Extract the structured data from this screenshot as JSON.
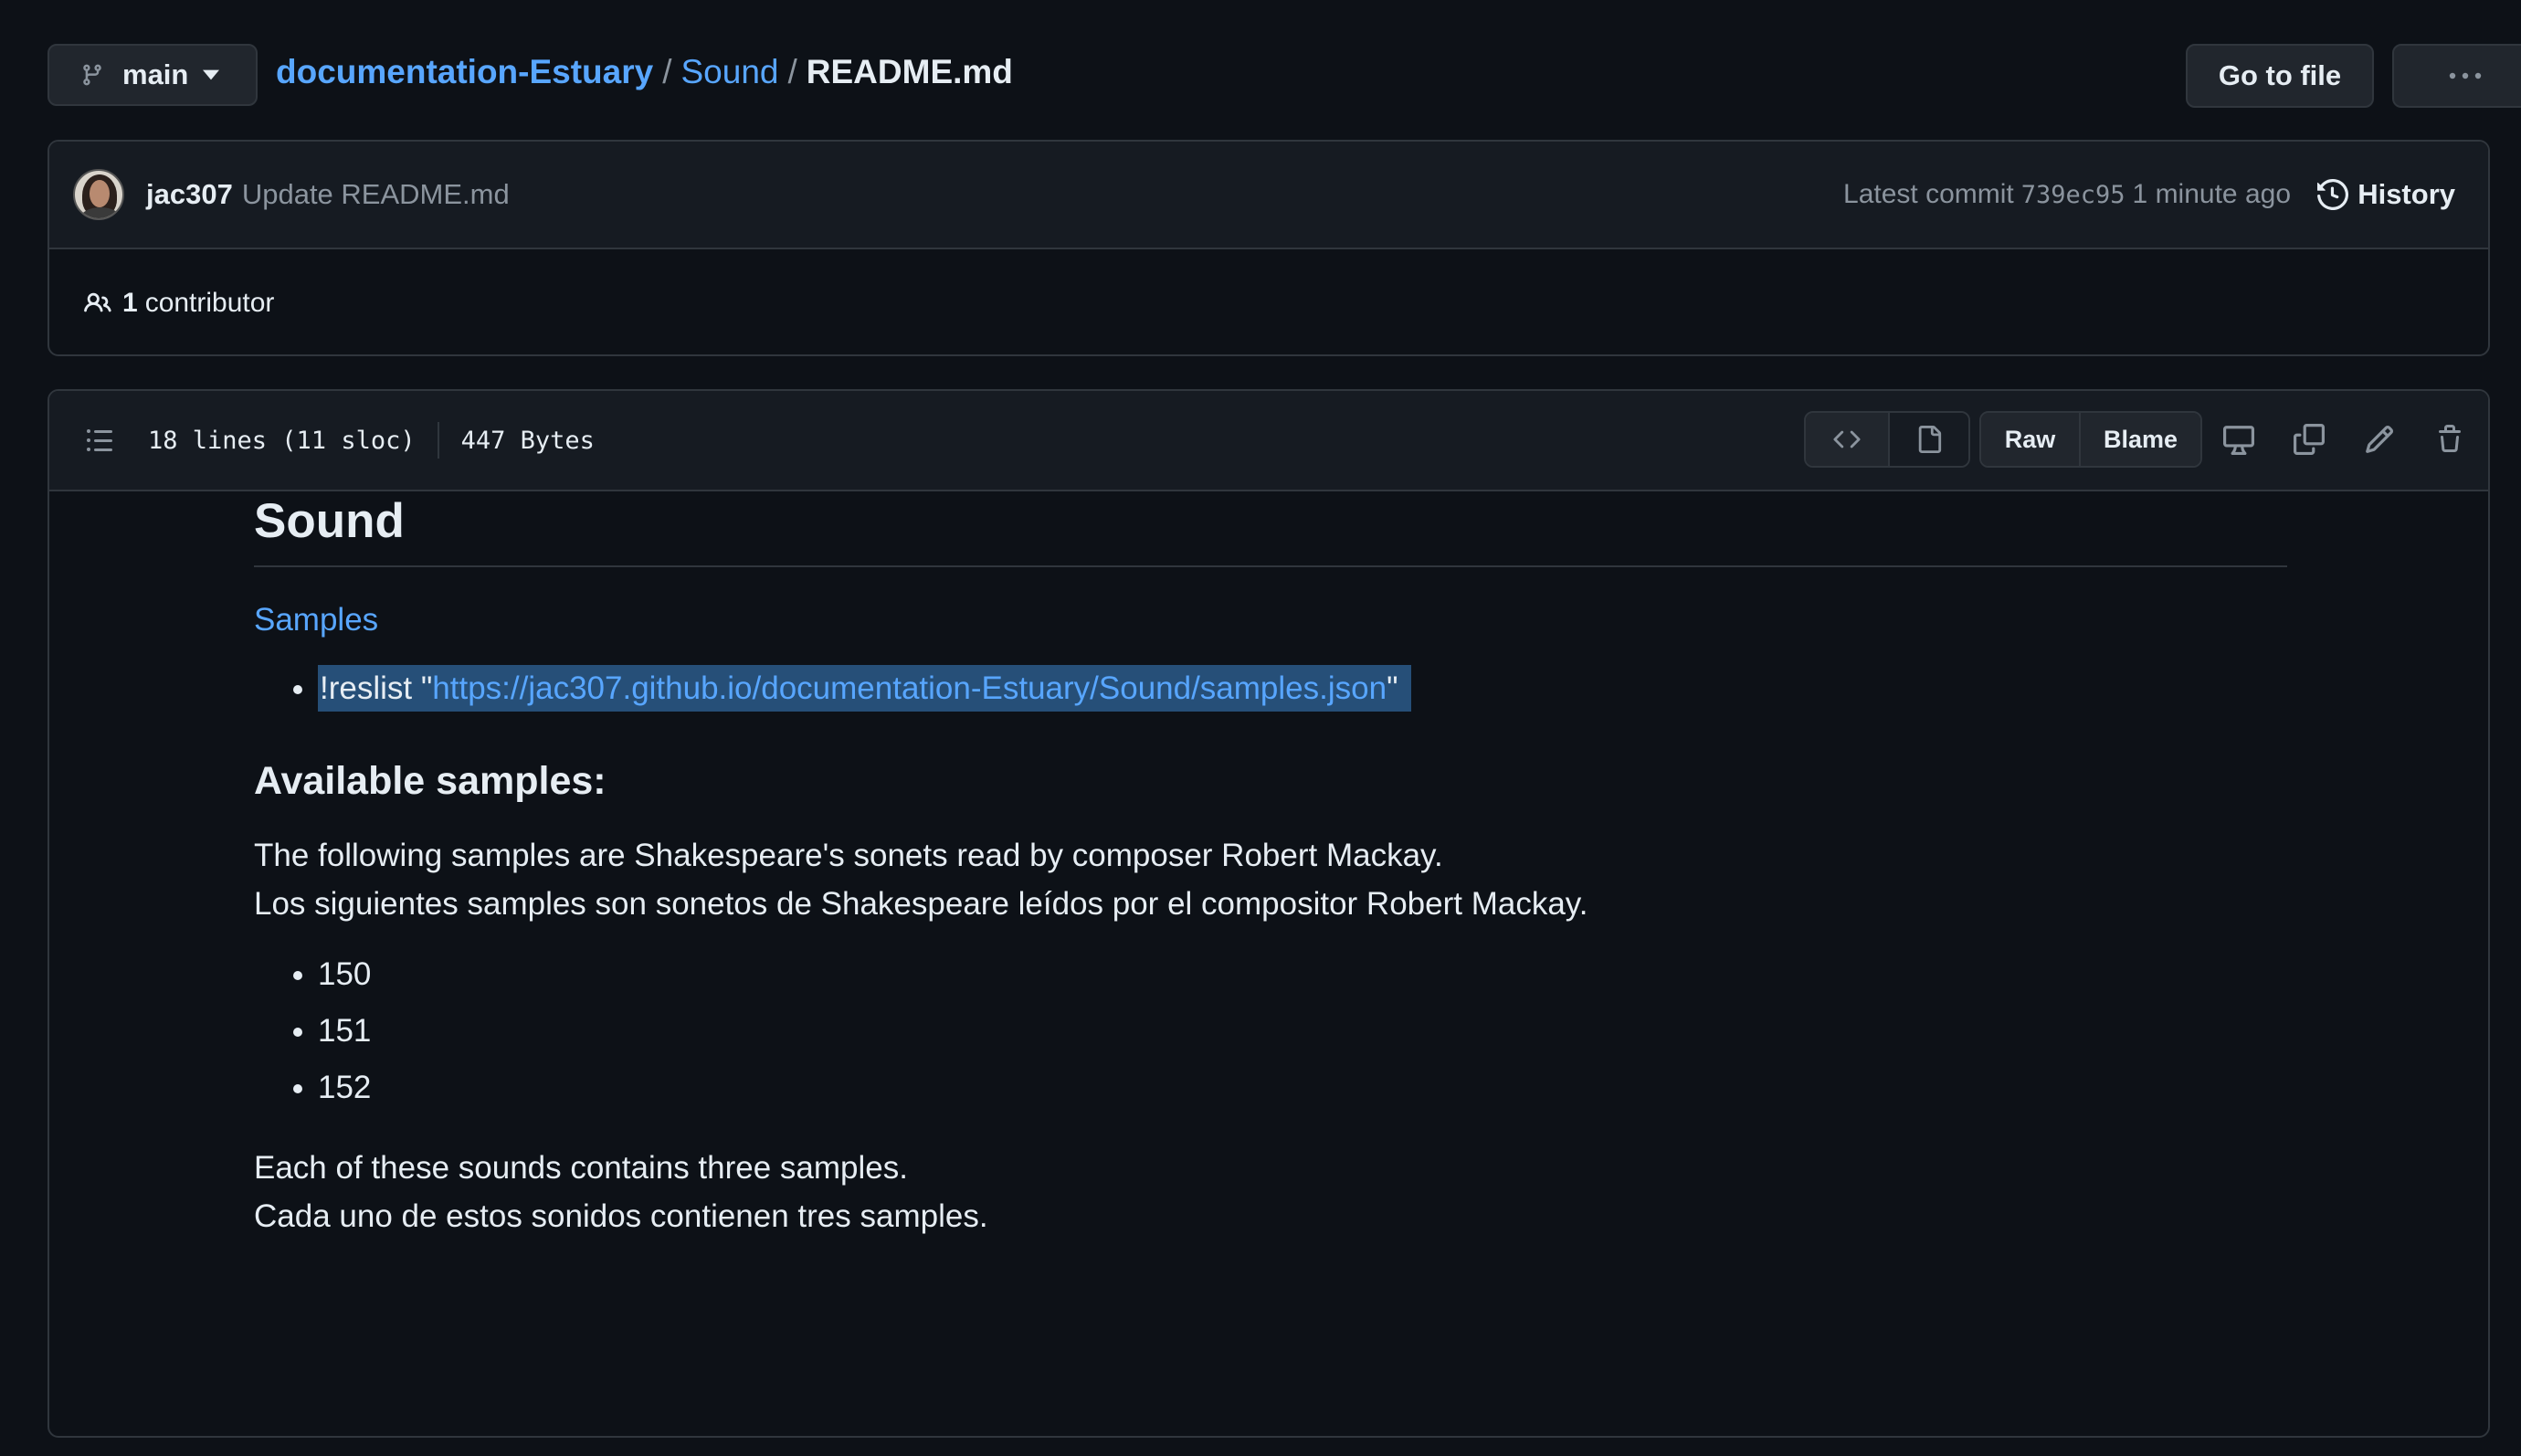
{
  "header": {
    "branch": "main",
    "breadcrumb": {
      "repo": "documentation-Estuary",
      "folder": "Sound",
      "file": "README.md",
      "separator": "/"
    },
    "go_to_file": "Go to file"
  },
  "commit": {
    "author": "jac307",
    "message": "Update README.md",
    "latest_label": "Latest commit",
    "sha": "739ec95",
    "time": "1 minute ago",
    "history_label": "History",
    "contributors_count": "1",
    "contributors_label": "contributor"
  },
  "file": {
    "lines": "18 lines (11 sloc)",
    "size": "447 Bytes",
    "raw_label": "Raw",
    "blame_label": "Blame"
  },
  "readme": {
    "title": "Sound",
    "samples_link": "Samples",
    "reslist_prefix": "!reslist \"",
    "reslist_url": "https://jac307.github.io/documentation-Estuary/Sound/samples.json",
    "reslist_suffix": "\"",
    "available_heading": "Available samples:",
    "para1_en": "The following samples are Shakespeare's sonets read by composer Robert Mackay.",
    "para1_es": "Los siguientes samples son sonetos de Shakespeare leídos por el compositor Robert Mackay.",
    "samples": [
      "150",
      "151",
      "152"
    ],
    "para2_en": "Each of these sounds contains three samples.",
    "para2_es": "Cada uno de estos sonidos contienen tres samples."
  },
  "colors": {
    "background": "#0d1117",
    "link": "#58a6ff",
    "selection": "#264f78"
  }
}
